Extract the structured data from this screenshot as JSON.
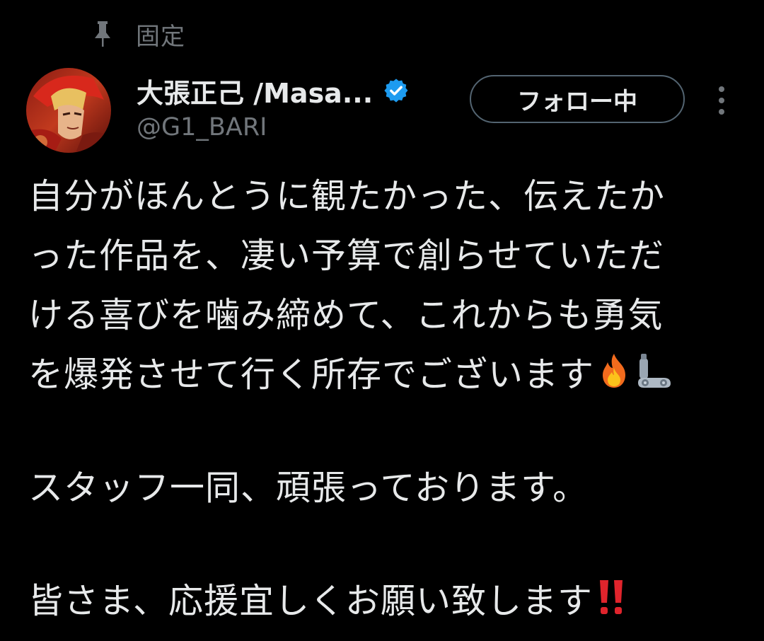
{
  "pinned": {
    "label": "固定",
    "icon": "pin-icon"
  },
  "author": {
    "display_name": "大張正己 /Masa...",
    "handle": "@G1_BARI",
    "verified": true,
    "verified_icon": "verified-badge-icon",
    "verified_color": "#1d9bf0"
  },
  "follow_button": {
    "label": "フォロー中"
  },
  "more_icon": "more-vertical-icon",
  "tweet": {
    "paragraph1": [
      "自分がほんとうに観たかった、伝えたか",
      "った作品を、凄い予算で創らせていただ",
      "ける喜びを噛み締めて、これからも勇気",
      "を爆発させて行く所存でございます"
    ],
    "paragraph1_emojis": [
      "fire-emoji",
      "mechanical-arm-emoji"
    ],
    "paragraph2": "スタッフ一同、頑張っております。",
    "paragraph3": "皆さま、応援宜しくお願い致します",
    "paragraph3_emoji": "double-exclamation-emoji"
  },
  "colors": {
    "background": "#000000",
    "text_primary": "#e7e9ea",
    "text_secondary": "#71767b",
    "button_border": "#536471",
    "accent": "#1d9bf0",
    "exclamation": "#e0242c"
  }
}
